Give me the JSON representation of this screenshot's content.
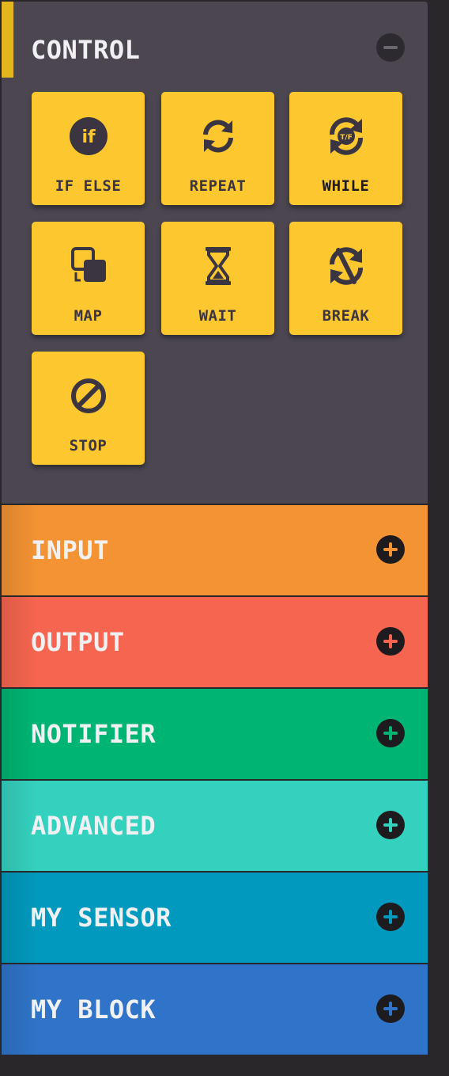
{
  "colors": {
    "control_bg": "#4b4650",
    "control_accent": "#e3b620",
    "tile": "#fcc72f",
    "input": "#f39333",
    "output": "#f6654f",
    "notifier": "#00b573",
    "advanced": "#35d1bf",
    "my_sensor": "#0199bd",
    "my_block": "#2f74c8"
  },
  "control": {
    "title": "CONTROL",
    "toggle_icon": "minus-icon",
    "tiles": [
      {
        "label": "IF ELSE",
        "icon": "if-else-icon"
      },
      {
        "label": "REPEAT",
        "icon": "repeat-icon"
      },
      {
        "label": "WHILE",
        "icon": "while-icon"
      },
      {
        "label": "MAP",
        "icon": "map-icon"
      },
      {
        "label": "WAIT",
        "icon": "hourglass-icon"
      },
      {
        "label": "BREAK",
        "icon": "break-icon"
      },
      {
        "label": "STOP",
        "icon": "stop-icon"
      }
    ],
    "icon_text": {
      "if": "if",
      "tf": "T/F"
    }
  },
  "categories": [
    {
      "label": "INPUT",
      "toggle_icon": "plus-icon"
    },
    {
      "label": "OUTPUT",
      "toggle_icon": "plus-icon"
    },
    {
      "label": "NOTIFIER",
      "toggle_icon": "plus-icon"
    },
    {
      "label": "ADVANCED",
      "toggle_icon": "plus-icon"
    },
    {
      "label": "MY SENSOR",
      "toggle_icon": "plus-icon"
    },
    {
      "label": "MY BLOCK",
      "toggle_icon": "plus-icon"
    }
  ]
}
